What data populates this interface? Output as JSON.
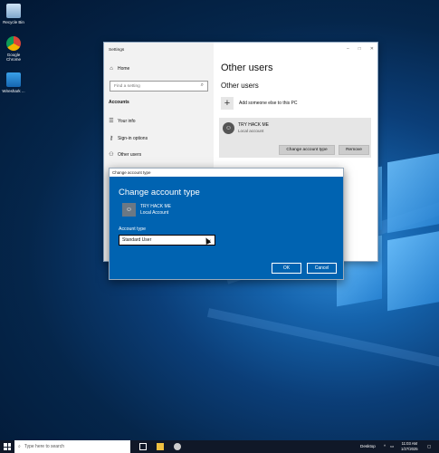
{
  "desktop": {
    "icons": [
      {
        "label": "Recycle Bin",
        "icon": "recycle-bin-icon"
      },
      {
        "label": "Google Chrome",
        "icon": "chrome-icon"
      },
      {
        "label": "Wireshark ...",
        "icon": "wireshark-icon"
      }
    ]
  },
  "settings": {
    "window_title": "Settings",
    "nav": {
      "home": "Home",
      "search_placeholder": "Find a setting",
      "section": "Accounts",
      "items": [
        "Your info",
        "Sign-in options",
        "Other users"
      ]
    },
    "page_title": "Other users",
    "sub_title": "Other users",
    "add_label": "Add someone else to this PC",
    "user_card": {
      "name": "TRY HACK ME",
      "type": "Local account",
      "change_button": "Change account type",
      "remove_button": "Remove"
    }
  },
  "dialog": {
    "window_title": "Change account type",
    "heading": "Change account type",
    "user_name": "TRY HACK ME",
    "user_type": "Local Account",
    "account_type_label": "Account type",
    "account_type_value": "Standard User",
    "ok_label": "OK",
    "cancel_label": "Cancel"
  },
  "taskbar": {
    "search_placeholder": "Type here to search",
    "desktop_label": "Desktop",
    "time": "11:03 AM",
    "date": "1/27/2025"
  },
  "colors": {
    "dialog_bg": "#0063b1",
    "taskbar_bg": "#101828"
  }
}
